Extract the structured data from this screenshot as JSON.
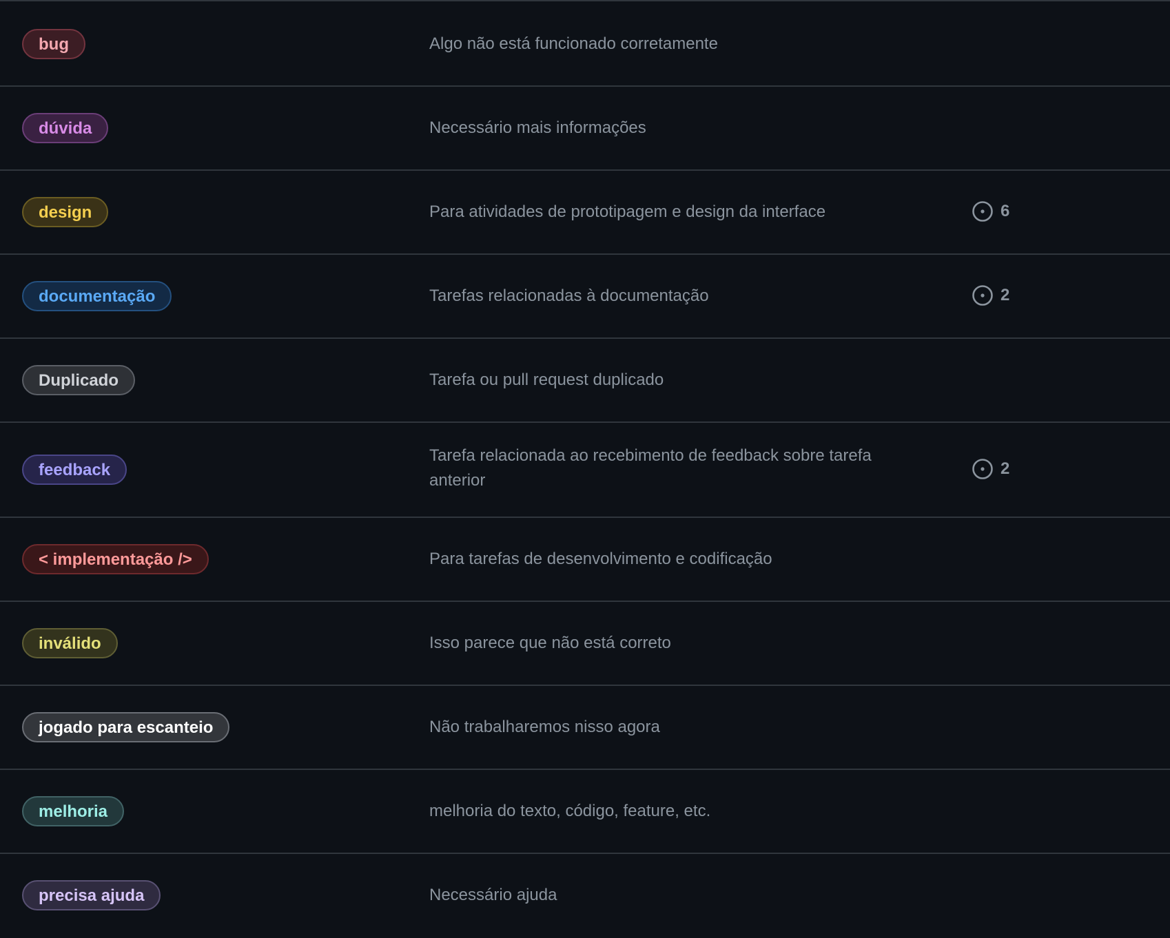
{
  "labels": [
    {
      "name": "bug",
      "description": "Algo não está funcionado corretamente",
      "count": "",
      "text_color": "#f4a8b0",
      "bg_color": "#3c1d24",
      "border_color": "#73343f"
    },
    {
      "name": "dúvida",
      "description": "Necessário mais informações",
      "count": "",
      "text_color": "#d88be6",
      "bg_color": "#3a2142",
      "border_color": "#6b3e78"
    },
    {
      "name": "design",
      "description": "Para atividades de prototipagem e design da interface",
      "count": "6",
      "text_color": "#f5cf4f",
      "bg_color": "#3a3217",
      "border_color": "#6b5d22"
    },
    {
      "name": "documentação",
      "description": "Tarefas relacionadas à documentação",
      "count": "2",
      "text_color": "#5aa9f5",
      "bg_color": "#132a45",
      "border_color": "#24507f"
    },
    {
      "name": "Duplicado",
      "description": "Tarefa ou pull request duplicado",
      "count": "",
      "text_color": "#d0d3d8",
      "bg_color": "#2e3136",
      "border_color": "#5b5f66"
    },
    {
      "name": "feedback",
      "description": "Tarefa relacionada ao recebimento de feedback sobre tarefa anterior",
      "count": "2",
      "text_color": "#a9a4ff",
      "bg_color": "#26244a",
      "border_color": "#4a4688"
    },
    {
      "name": "< implementação />",
      "description": "Para tarefas de desenvolvimento e codificação",
      "count": "",
      "text_color": "#ff9a9a",
      "bg_color": "#3a1719",
      "border_color": "#6e2a2d"
    },
    {
      "name": "inválido",
      "description": "Isso parece que não está correto",
      "count": "",
      "text_color": "#e4e07a",
      "bg_color": "#33331d",
      "border_color": "#5f5e34"
    },
    {
      "name": "jogado para escanteio",
      "description": "Não trabalharemos nisso agora",
      "count": "",
      "text_color": "#ffffff",
      "bg_color": "#33363b",
      "border_color": "#6a6e75"
    },
    {
      "name": "melhoria",
      "description": "melhoria do texto, código, feature, etc.",
      "count": "",
      "text_color": "#9eeee6",
      "bg_color": "#22383b",
      "border_color": "#416366"
    },
    {
      "name": "precisa ajuda",
      "description": "Necessário ajuda",
      "count": "",
      "text_color": "#d6c4f7",
      "bg_color": "#2f2b40",
      "border_color": "#595173"
    }
  ],
  "issue_icon": "issue-opened-icon"
}
